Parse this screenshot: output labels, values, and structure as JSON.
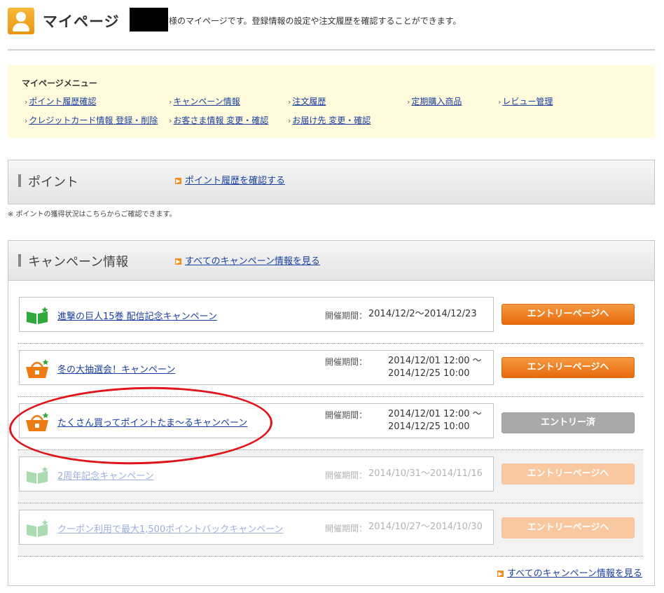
{
  "header": {
    "title": "マイページ",
    "description": "様のマイページです。登録情報の設定や注文履歴を確認することができます。"
  },
  "menu": {
    "title": "マイページメニュー",
    "items": [
      {
        "label": "ポイント履歴確認"
      },
      {
        "label": "キャンペーン情報"
      },
      {
        "label": "注文履歴"
      },
      {
        "label": "定期購入商品"
      },
      {
        "label": "レビュー管理"
      },
      {
        "label": "クレジットカード情報 登録・削除"
      },
      {
        "label": "お客さま情報 変更・確認"
      },
      {
        "label": "お届け先 変更・確認"
      }
    ]
  },
  "point": {
    "title": "ポイント",
    "link": "ポイント履歴を確認する",
    "note": "※ ポイントの獲得状況はこちらからご確認できます。"
  },
  "campaign": {
    "title": "キャンペーン情報",
    "header_link": "すべてのキャンペーン情報を見る",
    "bottom_link": "すべてのキャンペーン情報を見る",
    "period_label": "開催期間：",
    "items": [
      {
        "name": "進撃の巨人15巻 配信記念キャンペーン",
        "icon": "book-icon",
        "period": "2014/12/2〜2014/12/23",
        "button": "エントリーページへ",
        "state": "active"
      },
      {
        "name": "冬の大抽選会！キャンペーン",
        "icon": "basket-icon",
        "period_start": "2014/12/01 12:00 〜",
        "period_end": "2014/12/25 10:00",
        "button": "エントリーページへ",
        "state": "active"
      },
      {
        "name": "たくさん買ってポイントたま〜るキャンペーン",
        "icon": "basket-icon",
        "period_start": "2014/12/01 12:00 〜",
        "period_end": "2014/12/25 10:00",
        "button": "エントリー済",
        "state": "entered"
      },
      {
        "name": "2周年記念キャンペーン",
        "icon": "book-icon",
        "period": "2014/10/31〜2014/11/16",
        "button": "エントリーページへ",
        "state": "expired"
      },
      {
        "name": "クーポン利用で最大1,500ポイントバックキャンペーン",
        "icon": "book-icon",
        "period": "2014/10/27〜2014/10/30",
        "button": "エントリーページへ",
        "state": "expired"
      }
    ]
  },
  "colors": {
    "accent": "#e8690b",
    "link": "#1a3fa0",
    "highlight_circle": "#e0141c",
    "menu_bg": "#fffbdc"
  }
}
